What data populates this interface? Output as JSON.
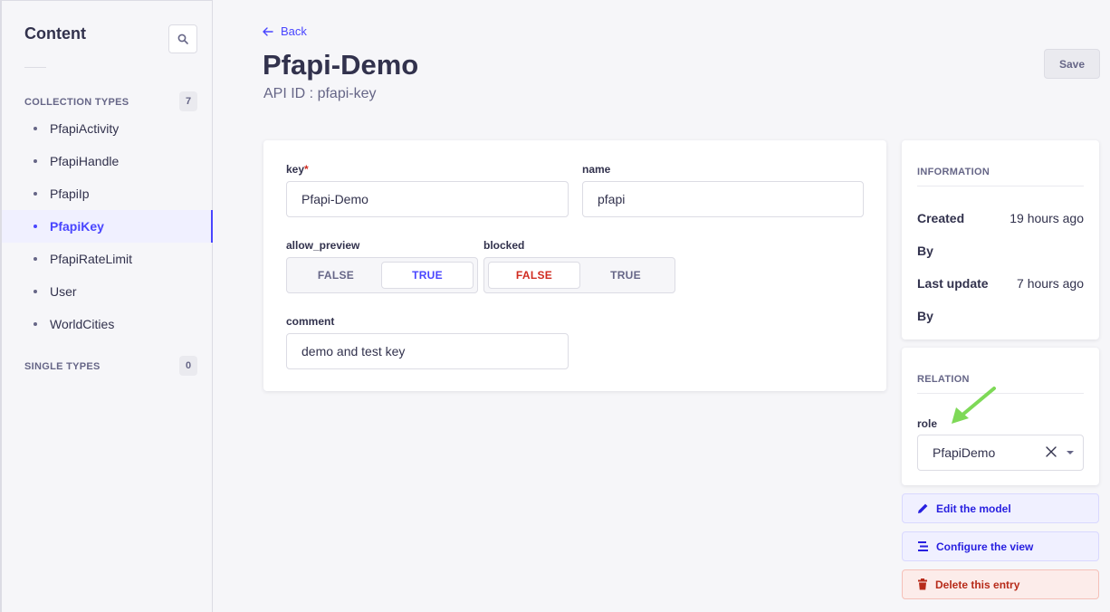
{
  "sidebar": {
    "title": "Content",
    "collection_label": "COLLECTION TYPES",
    "collection_count": "7",
    "items": [
      {
        "label": "PfapiActivity"
      },
      {
        "label": "PfapiHandle"
      },
      {
        "label": "PfapiIp"
      },
      {
        "label": "PfapiKey"
      },
      {
        "label": "PfapiRateLimit"
      },
      {
        "label": "User"
      },
      {
        "label": "WorldCities"
      }
    ],
    "single_label": "SINGLE TYPES",
    "single_count": "0"
  },
  "header": {
    "back_label": "Back",
    "title": "Pfapi-Demo",
    "api_id": "API ID : pfapi-key",
    "save_label": "Save"
  },
  "form": {
    "key_label": "key",
    "key_required": "*",
    "key_value": "Pfapi-Demo",
    "name_label": "name",
    "name_value": "pfapi",
    "allow_preview_label": "allow_preview",
    "allow_preview_false": "FALSE",
    "allow_preview_true": "TRUE",
    "blocked_label": "blocked",
    "blocked_false": "FALSE",
    "blocked_true": "TRUE",
    "comment_label": "comment",
    "comment_value": "demo and test key"
  },
  "information": {
    "heading": "INFORMATION",
    "created_label": "Created",
    "created_value": "19 hours ago",
    "created_by_label": "By",
    "updated_label": "Last update",
    "updated_value": "7 hours ago",
    "updated_by_label": "By"
  },
  "relation": {
    "heading": "RELATION",
    "role_label": "role",
    "role_value": "PfapiDemo"
  },
  "actions": {
    "edit_model": "Edit the model",
    "configure_view": "Configure the view",
    "delete_entry": "Delete this entry"
  },
  "colors": {
    "primary": "#4945ff",
    "danger": "#d02b20",
    "annotation_arrow": "#7ed957"
  }
}
